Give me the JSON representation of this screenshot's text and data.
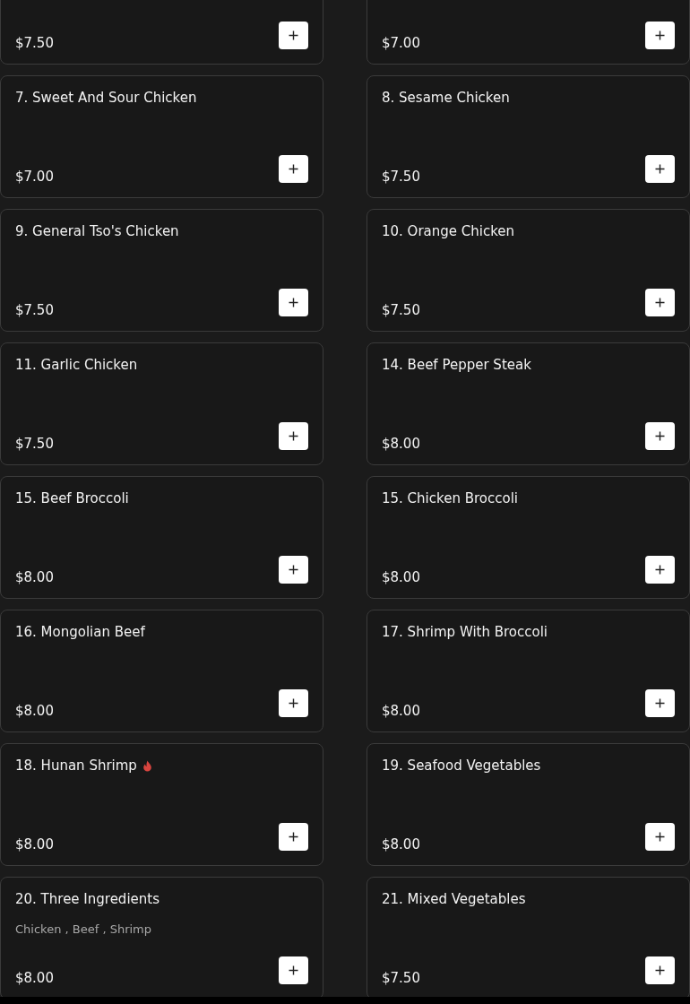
{
  "items": [
    {
      "price": "$7.50"
    },
    {
      "price": "$7.00"
    },
    {
      "title": "7. Sweet And Sour Chicken",
      "price": "$7.00",
      "spicy": false
    },
    {
      "title": "8. Sesame Chicken",
      "price": "$7.50",
      "spicy": false
    },
    {
      "title": "9. General Tso's Chicken",
      "price": "$7.50",
      "spicy": false
    },
    {
      "title": "10. Orange Chicken",
      "price": "$7.50",
      "spicy": false
    },
    {
      "title": "11. Garlic Chicken",
      "price": "$7.50",
      "spicy": false
    },
    {
      "title": "14. Beef Pepper Steak",
      "price": "$8.00",
      "spicy": false
    },
    {
      "title": "15. Beef Broccoli",
      "price": "$8.00",
      "spicy": false
    },
    {
      "title": "15. Chicken Broccoli",
      "price": "$8.00",
      "spicy": false
    },
    {
      "title": "16. Mongolian Beef",
      "price": "$8.00",
      "spicy": false
    },
    {
      "title": "17. Shrimp With Broccoli",
      "price": "$8.00",
      "spicy": false
    },
    {
      "title": "18. Hunan Shrimp",
      "price": "$8.00",
      "spicy": true
    },
    {
      "title": "19. Seafood Vegetables",
      "price": "$8.00",
      "spicy": false
    },
    {
      "title": "20. Three Ingredients",
      "description": "Chicken , Beef , Shrimp",
      "price": "$8.00",
      "spicy": false
    },
    {
      "title": "21. Mixed Vegetables",
      "price": "$7.50",
      "spicy": false
    }
  ]
}
